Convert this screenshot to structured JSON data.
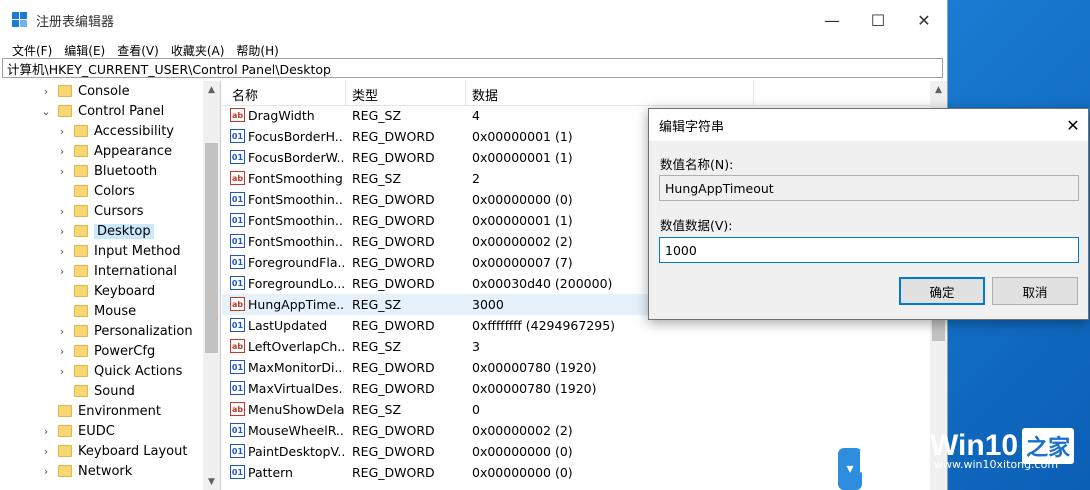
{
  "window": {
    "title": "注册表编辑器",
    "minimize": "—",
    "maximize": "☐",
    "close": "✕"
  },
  "menu": [
    "文件(F)",
    "编辑(E)",
    "查看(V)",
    "收藏夹(A)",
    "帮助(H)"
  ],
  "address": "计算机\\HKEY_CURRENT_USER\\Control Panel\\Desktop",
  "tree": [
    {
      "label": "Console",
      "chev": "›"
    },
    {
      "label": "Control Panel",
      "chev": "⌄"
    },
    {
      "label": "Accessibility",
      "chev": "›"
    },
    {
      "label": "Appearance",
      "chev": "›"
    },
    {
      "label": "Bluetooth",
      "chev": "›"
    },
    {
      "label": "Colors",
      "chev": ""
    },
    {
      "label": "Cursors",
      "chev": "›"
    },
    {
      "label": "Desktop",
      "chev": "›"
    },
    {
      "label": "Input Method",
      "chev": "›"
    },
    {
      "label": "International",
      "chev": "›"
    },
    {
      "label": "Keyboard",
      "chev": ""
    },
    {
      "label": "Mouse",
      "chev": ""
    },
    {
      "label": "Personalization",
      "chev": "›"
    },
    {
      "label": "PowerCfg",
      "chev": "›"
    },
    {
      "label": "Quick Actions",
      "chev": "›"
    },
    {
      "label": "Sound",
      "chev": ""
    },
    {
      "label": "Environment",
      "chev": ""
    },
    {
      "label": "EUDC",
      "chev": "›"
    },
    {
      "label": "Keyboard Layout",
      "chev": "›"
    },
    {
      "label": "Network",
      "chev": "›"
    }
  ],
  "columns": [
    "名称",
    "类型",
    "数据"
  ],
  "values": [
    {
      "name": "DragWidth",
      "type": "REG_SZ",
      "data": "4"
    },
    {
      "name": "FocusBorderH...",
      "type": "REG_DWORD",
      "data": "0x00000001 (1)"
    },
    {
      "name": "FocusBorderW...",
      "type": "REG_DWORD",
      "data": "0x00000001 (1)"
    },
    {
      "name": "FontSmoothing",
      "type": "REG_SZ",
      "data": "2"
    },
    {
      "name": "FontSmoothin...",
      "type": "REG_DWORD",
      "data": "0x00000000 (0)"
    },
    {
      "name": "FontSmoothin...",
      "type": "REG_DWORD",
      "data": "0x00000001 (1)"
    },
    {
      "name": "FontSmoothin...",
      "type": "REG_DWORD",
      "data": "0x00000002 (2)"
    },
    {
      "name": "ForegroundFla...",
      "type": "REG_DWORD",
      "data": "0x00000007 (7)"
    },
    {
      "name": "ForegroundLo...",
      "type": "REG_DWORD",
      "data": "0x00030d40 (200000)"
    },
    {
      "name": "HungAppTime...",
      "type": "REG_SZ",
      "data": "3000"
    },
    {
      "name": "LastUpdated",
      "type": "REG_DWORD",
      "data": "0xffffffff (4294967295)"
    },
    {
      "name": "LeftOverlapCh...",
      "type": "REG_SZ",
      "data": "3"
    },
    {
      "name": "MaxMonitorDi...",
      "type": "REG_DWORD",
      "data": "0x00000780 (1920)"
    },
    {
      "name": "MaxVirtualDes...",
      "type": "REG_DWORD",
      "data": "0x00000780 (1920)"
    },
    {
      "name": "MenuShowDelay",
      "type": "REG_SZ",
      "data": "0"
    },
    {
      "name": "MouseWheelR...",
      "type": "REG_DWORD",
      "data": "0x00000002 (2)"
    },
    {
      "name": "PaintDesktopV...",
      "type": "REG_DWORD",
      "data": "0x00000000 (0)"
    },
    {
      "name": "Pattern",
      "type": "REG_DWORD",
      "data": "0x00000000 (0)"
    }
  ],
  "dialog": {
    "title": "编辑字符串",
    "close": "✕",
    "name_label": "数值名称(N):",
    "name_value": "HungAppTimeout",
    "data_label": "数值数据(V):",
    "data_value": "1000",
    "ok": "确定",
    "cancel": "取消"
  },
  "brand": {
    "text": "Win10",
    "text2": "之家",
    "url": "www.win10xitong.com"
  }
}
